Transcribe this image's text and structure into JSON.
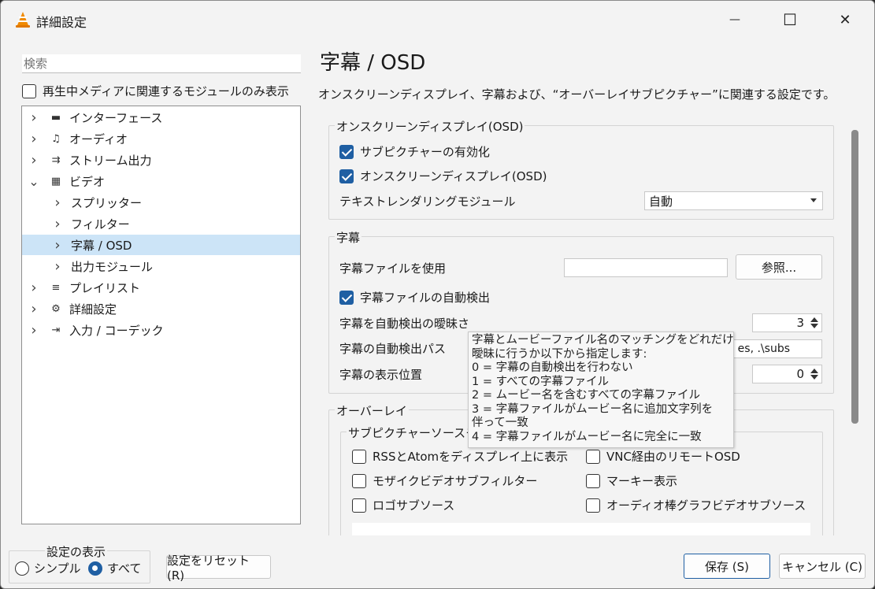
{
  "window": {
    "title": "詳細設定",
    "minimize_glyph": "—",
    "maximize_glyph": "☐",
    "close_glyph": "✕"
  },
  "sidebar": {
    "search_placeholder": "検索",
    "only_current_label": "再生中メディアに関連するモジュールのみ表示",
    "only_current_checked": false,
    "tree": [
      {
        "label": "インターフェース",
        "icon": "interface-icon",
        "glyph": "▬",
        "level": 0,
        "expanded": false,
        "selected": false
      },
      {
        "label": "オーディオ",
        "icon": "audio-icon",
        "glyph": "♫",
        "level": 0,
        "expanded": false,
        "selected": false
      },
      {
        "label": "ストリーム出力",
        "icon": "stream-output-icon",
        "glyph": "⇉",
        "level": 0,
        "expanded": false,
        "selected": false
      },
      {
        "label": "ビデオ",
        "icon": "video-icon",
        "glyph": "▦",
        "level": 0,
        "expanded": true,
        "selected": false
      },
      {
        "label": "スプリッター",
        "icon": "",
        "glyph": "",
        "level": 1,
        "expanded": false,
        "selected": false
      },
      {
        "label": "フィルター",
        "icon": "",
        "glyph": "",
        "level": 1,
        "expanded": false,
        "selected": false
      },
      {
        "label": "字幕 / OSD",
        "icon": "",
        "glyph": "",
        "level": 1,
        "expanded": false,
        "selected": true
      },
      {
        "label": "出力モジュール",
        "icon": "",
        "glyph": "",
        "level": 1,
        "expanded": false,
        "selected": false
      },
      {
        "label": "プレイリスト",
        "icon": "playlist-icon",
        "glyph": "≡",
        "level": 0,
        "expanded": false,
        "selected": false
      },
      {
        "label": "詳細設定",
        "icon": "advanced-settings-icon",
        "glyph": "⚙",
        "level": 0,
        "expanded": false,
        "selected": false
      },
      {
        "label": "入力 / コーデック",
        "icon": "input-codec-icon",
        "glyph": "⇥",
        "level": 0,
        "expanded": false,
        "selected": false
      }
    ]
  },
  "main": {
    "title": "字幕 / OSD",
    "description": "オンスクリーンディスプレイ、字幕および、“オーバーレイサブピクチャー”に関連する設定です。",
    "osd_group": {
      "title": "オンスクリーンディスプレイ(OSD)",
      "subpicture_enable_label": "サブピクチャーの有効化",
      "subpicture_enable_checked": true,
      "osd_label": "オンスクリーンディスプレイ(OSD)",
      "osd_checked": true,
      "text_rendering_label": "テキストレンダリングモジュール",
      "text_rendering_value": "自動"
    },
    "subtitles_group": {
      "title": "字幕",
      "use_file_label": "字幕ファイルを使用",
      "use_file_value": "",
      "browse_label": "参照...",
      "autodetect_label": "字幕ファイルの自動検出",
      "autodetect_checked": true,
      "fuzziness_label": "字幕を自動検出の曖昧さ",
      "fuzziness_value": "3",
      "path_label": "字幕の自動検出パス",
      "path_value": "es, .\\subs",
      "position_label": "字幕の表示位置",
      "position_value": "0"
    },
    "overlay_group": {
      "title": "オーバーレイ",
      "subpicture_source_title": "サブピクチャーソースモ",
      "options": [
        {
          "label": "RSSとAtomをディスプレイ上に表示",
          "checked": false
        },
        {
          "label": "VNC経由のリモートOSD",
          "checked": false
        },
        {
          "label": "モザイクビデオサブフィルター",
          "checked": false
        },
        {
          "label": "マーキー表示",
          "checked": false
        },
        {
          "label": "ロゴサブソース",
          "checked": false
        },
        {
          "label": "オーディオ棒グラフビデオサブソース",
          "checked": false
        }
      ]
    },
    "tooltip_lines": [
      "字幕とムービーファイル名のマッチングをどれだけ",
      "曖昧に行うか以下から指定します:",
      "0 = 字幕の自動検出を行わない",
      "1 = すべての字幕ファイル",
      "2 = ムービー名を含むすべての字幕ファイル",
      "3 = 字幕ファイルがムービー名に追加文字列を",
      "伴って一致",
      "4 = 字幕ファイルがムービー名に完全に一致"
    ]
  },
  "footer": {
    "display_group_title": "設定の表示",
    "simple_label": "シンプル",
    "simple_selected": false,
    "all_label": "すべて",
    "all_selected": true,
    "reset_label": "設定をリセット (R)",
    "save_label": "保存 (S)",
    "cancel_label": "キャンセル (C)"
  },
  "colors": {
    "accent": "#1f5fa3",
    "selection": "#cce4f7",
    "window_bg": "#f3f3f3"
  }
}
